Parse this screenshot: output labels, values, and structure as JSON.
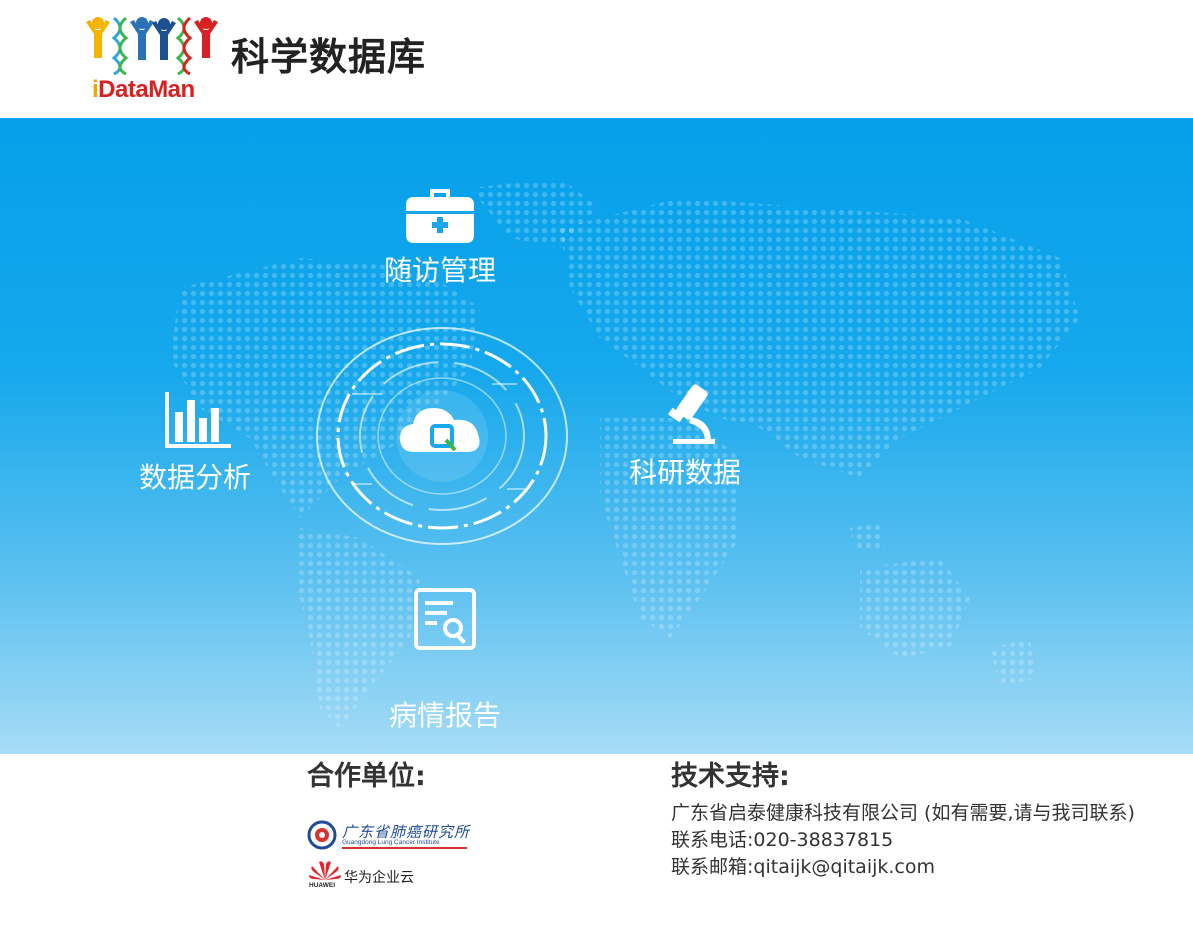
{
  "header": {
    "logo_text_i": "i",
    "logo_text_rest": "DataMan",
    "title": "科学数据库"
  },
  "modules": {
    "followup": {
      "label": "随访管理",
      "icon": "medical-kit-icon"
    },
    "analysis": {
      "label": "数据分析",
      "icon": "bar-chart-icon"
    },
    "research": {
      "label": "科研数据",
      "icon": "microscope-icon"
    },
    "report": {
      "label": "病情报告",
      "icon": "report-search-icon"
    },
    "center": {
      "icon": "cloud-q-icon"
    }
  },
  "footer": {
    "partners_title": "合作单位:",
    "partner1": {
      "cn": "广东省肺癌研究所",
      "en": "Guangdong Lung Cancer Institute"
    },
    "partner2": {
      "cn": "华为企业云",
      "en": "HUAWEI"
    },
    "support_title": "技术支持:",
    "company": "广东省启泰健康科技有限公司 (如有需要,请与我司联系)",
    "phone": "联系电话:020-38837815",
    "email": "联系邮箱:qitaijk@qitaijk.com"
  },
  "colors": {
    "banner_top": "#05a0ea",
    "banner_bottom": "#a6dcf6",
    "logo_red": "#d92121",
    "logo_orange": "#f4a300",
    "text_dark": "#333333"
  }
}
